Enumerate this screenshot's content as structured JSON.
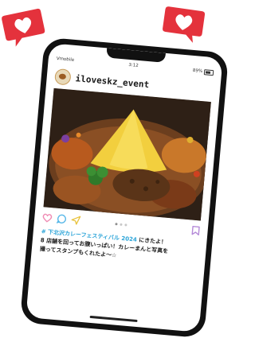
{
  "status_bar": {
    "carrier": "Vmobile",
    "time": "3:12",
    "battery": "89%"
  },
  "post": {
    "username": "iloveskz_event",
    "hashtag": "# 下北沢カレーフェスティバル 2024",
    "caption_line1_tail": " にきたよ！",
    "caption_line2": "8 店舗を回ってお腹いっぱい！カレーまんと写真を",
    "caption_line3": "撮ってスタンプもくれたよ～☆"
  },
  "colors": {
    "badge_red": "#e4323c",
    "hashtag_blue": "#2aa4d8",
    "like_pink": "#f08cb4",
    "comment_blue": "#58b8e8",
    "share_yellow": "#e8c23a",
    "bookmark_purple": "#b58ad8"
  },
  "icons": {
    "badge_left": "heart-badge-icon",
    "badge_right": "heart-badge-icon",
    "like": "heart-icon",
    "comment": "comment-icon",
    "share": "send-icon",
    "save": "bookmark-icon"
  },
  "carousel": {
    "count": 3,
    "active": 1
  }
}
